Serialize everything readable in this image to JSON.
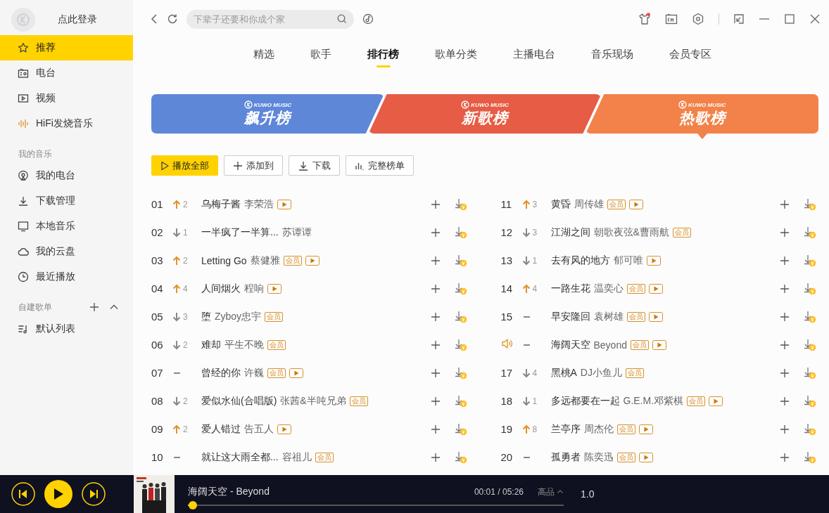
{
  "sidebar": {
    "login": "点此登录",
    "items": [
      {
        "label": "推荐",
        "selected": true
      },
      {
        "label": "电台",
        "selected": false
      },
      {
        "label": "视频",
        "selected": false
      },
      {
        "label": "HiFi发烧音乐",
        "selected": false
      }
    ],
    "sections": [
      {
        "title": "我的音乐",
        "actions": false,
        "items": [
          {
            "label": "我的电台",
            "selected": false
          },
          {
            "label": "下载管理",
            "selected": false
          },
          {
            "label": "本地音乐",
            "selected": false
          },
          {
            "label": "我的云盘",
            "selected": false
          },
          {
            "label": "最近播放",
            "selected": false
          }
        ]
      },
      {
        "title": "自建歌单",
        "actions": true,
        "items": [
          {
            "label": "默认列表",
            "selected": false
          }
        ]
      }
    ]
  },
  "search": {
    "placeholder": "下辈子还要和你成个家"
  },
  "tabs": [
    {
      "label": "精选",
      "selected": false
    },
    {
      "label": "歌手",
      "selected": false
    },
    {
      "label": "排行榜",
      "selected": true
    },
    {
      "label": "歌单分类",
      "selected": false
    },
    {
      "label": "主播电台",
      "selected": false
    },
    {
      "label": "音乐现场",
      "selected": false
    },
    {
      "label": "会员专区",
      "selected": false
    }
  ],
  "banners": [
    {
      "brand": "KUWO MUSIC",
      "title": "飙升榜",
      "color": "#5f87d8",
      "selected": false
    },
    {
      "brand": "KUWO MUSIC",
      "title": "新歌榜",
      "color": "#e65c45",
      "selected": false
    },
    {
      "brand": "KUWO MUSIC",
      "title": "热歌榜",
      "color": "#f2824a",
      "selected": true
    }
  ],
  "actions": [
    {
      "label": "播放全部",
      "kind": "play"
    },
    {
      "label": "添加到",
      "kind": "add"
    },
    {
      "label": "下载",
      "kind": "download"
    },
    {
      "label": "完整榜单",
      "kind": "chart"
    }
  ],
  "songs": [
    {
      "rank": "01",
      "playing": false,
      "trend": {
        "kind": "up",
        "change": "2"
      },
      "title": "乌梅子酱",
      "artist": "李荣浩",
      "tags": [
        {
          "kind": "mv"
        }
      ]
    },
    {
      "rank": "02",
      "playing": false,
      "trend": {
        "kind": "down",
        "change": "1"
      },
      "title": "一半疯了一半算...",
      "artist": "苏谭谭"
    },
    {
      "rank": "03",
      "playing": false,
      "trend": {
        "kind": "up",
        "change": "2"
      },
      "title": "Letting Go",
      "artist": "蔡健雅",
      "tags": [
        {
          "kind": "vip",
          "text": "会员"
        },
        {
          "kind": "mv"
        }
      ]
    },
    {
      "rank": "04",
      "playing": false,
      "trend": {
        "kind": "up",
        "change": "4"
      },
      "title": "人间烟火",
      "artist": "程响",
      "tags": [
        {
          "kind": "mv"
        }
      ]
    },
    {
      "rank": "05",
      "playing": false,
      "trend": {
        "kind": "down",
        "change": "3"
      },
      "title": "堕",
      "artist": "Zyboy忠宇",
      "tags": [
        {
          "kind": "vip",
          "text": "会员"
        }
      ]
    },
    {
      "rank": "06",
      "playing": false,
      "trend": {
        "kind": "down",
        "change": "2"
      },
      "title": "难却",
      "artist": "平生不晚",
      "tags": [
        {
          "kind": "vip",
          "text": "会员"
        }
      ]
    },
    {
      "rank": "07",
      "playing": false,
      "trend": {
        "kind": "same"
      },
      "title": "曾经的你",
      "artist": "许巍",
      "tags": [
        {
          "kind": "vip",
          "text": "会员"
        },
        {
          "kind": "mv"
        }
      ]
    },
    {
      "rank": "08",
      "playing": false,
      "trend": {
        "kind": "down",
        "change": "2"
      },
      "title": "爱似水仙(合唱版)",
      "artist": "张茜&半吨兄弟",
      "tags": [
        {
          "kind": "vip",
          "text": "会员"
        }
      ]
    },
    {
      "rank": "09",
      "playing": false,
      "trend": {
        "kind": "up",
        "change": "2"
      },
      "title": "爱人错过",
      "artist": "告五人",
      "tags": [
        {
          "kind": "mv"
        }
      ]
    },
    {
      "rank": "10",
      "playing": false,
      "trend": {
        "kind": "same"
      },
      "title": "就让这大雨全都...",
      "artist": "容祖儿",
      "tags": [
        {
          "kind": "vip",
          "text": "会员"
        }
      ]
    },
    {
      "rank": "11",
      "playing": false,
      "trend": {
        "kind": "up",
        "change": "3"
      },
      "title": "黄昏",
      "artist": "周传雄",
      "tags": [
        {
          "kind": "vip",
          "text": "会员"
        },
        {
          "kind": "mv"
        }
      ]
    },
    {
      "rank": "12",
      "playing": false,
      "trend": {
        "kind": "down",
        "change": "3"
      },
      "title": "江湖之间",
      "artist": "朝歌夜弦&曹雨航",
      "tags": [
        {
          "kind": "vip",
          "text": "会员"
        }
      ]
    },
    {
      "rank": "13",
      "playing": false,
      "trend": {
        "kind": "down",
        "change": "1"
      },
      "title": "去有风的地方",
      "artist": "郁可唯",
      "tags": [
        {
          "kind": "mv"
        }
      ]
    },
    {
      "rank": "14",
      "playing": false,
      "trend": {
        "kind": "up",
        "change": "4"
      },
      "title": "一路生花",
      "artist": "温奕心",
      "tags": [
        {
          "kind": "vip",
          "text": "会员"
        },
        {
          "kind": "mv"
        }
      ]
    },
    {
      "rank": "15",
      "playing": false,
      "trend": {
        "kind": "same"
      },
      "title": "早安隆回",
      "artist": "袁树雄",
      "tags": [
        {
          "kind": "vip",
          "text": "会员"
        },
        {
          "kind": "mv"
        }
      ]
    },
    {
      "playing": true,
      "trend": {
        "kind": "same"
      },
      "title": "海阔天空",
      "artist": "Beyond",
      "tags": [
        {
          "kind": "vip",
          "text": "会员"
        },
        {
          "kind": "mv"
        }
      ]
    },
    {
      "rank": "17",
      "playing": false,
      "trend": {
        "kind": "down",
        "change": "4"
      },
      "title": "黑桃A",
      "artist": "DJ小鱼儿",
      "tags": [
        {
          "kind": "vip",
          "text": "会员"
        }
      ]
    },
    {
      "rank": "18",
      "playing": false,
      "trend": {
        "kind": "down",
        "change": "1"
      },
      "title": "多远都要在一起",
      "artist": "G.E.M.邓紫棋",
      "tags": [
        {
          "kind": "vip",
          "text": "会员"
        },
        {
          "kind": "mv"
        }
      ]
    },
    {
      "rank": "19",
      "playing": false,
      "trend": {
        "kind": "up",
        "change": "8"
      },
      "title": "兰亭序",
      "artist": "周杰伦",
      "tags": [
        {
          "kind": "vip",
          "text": "会员"
        },
        {
          "kind": "mv"
        }
      ]
    },
    {
      "rank": "20",
      "playing": false,
      "trend": {
        "kind": "same"
      },
      "title": "孤勇者",
      "artist": "陈奕迅",
      "tags": [
        {
          "kind": "vip",
          "text": "会员"
        },
        {
          "kind": "mv"
        }
      ]
    }
  ],
  "player": {
    "track": "海阔天空 - Beyond",
    "time": "00:01 / 05:26",
    "quality": "高品",
    "speed": "1.0",
    "level": 0.002
  }
}
